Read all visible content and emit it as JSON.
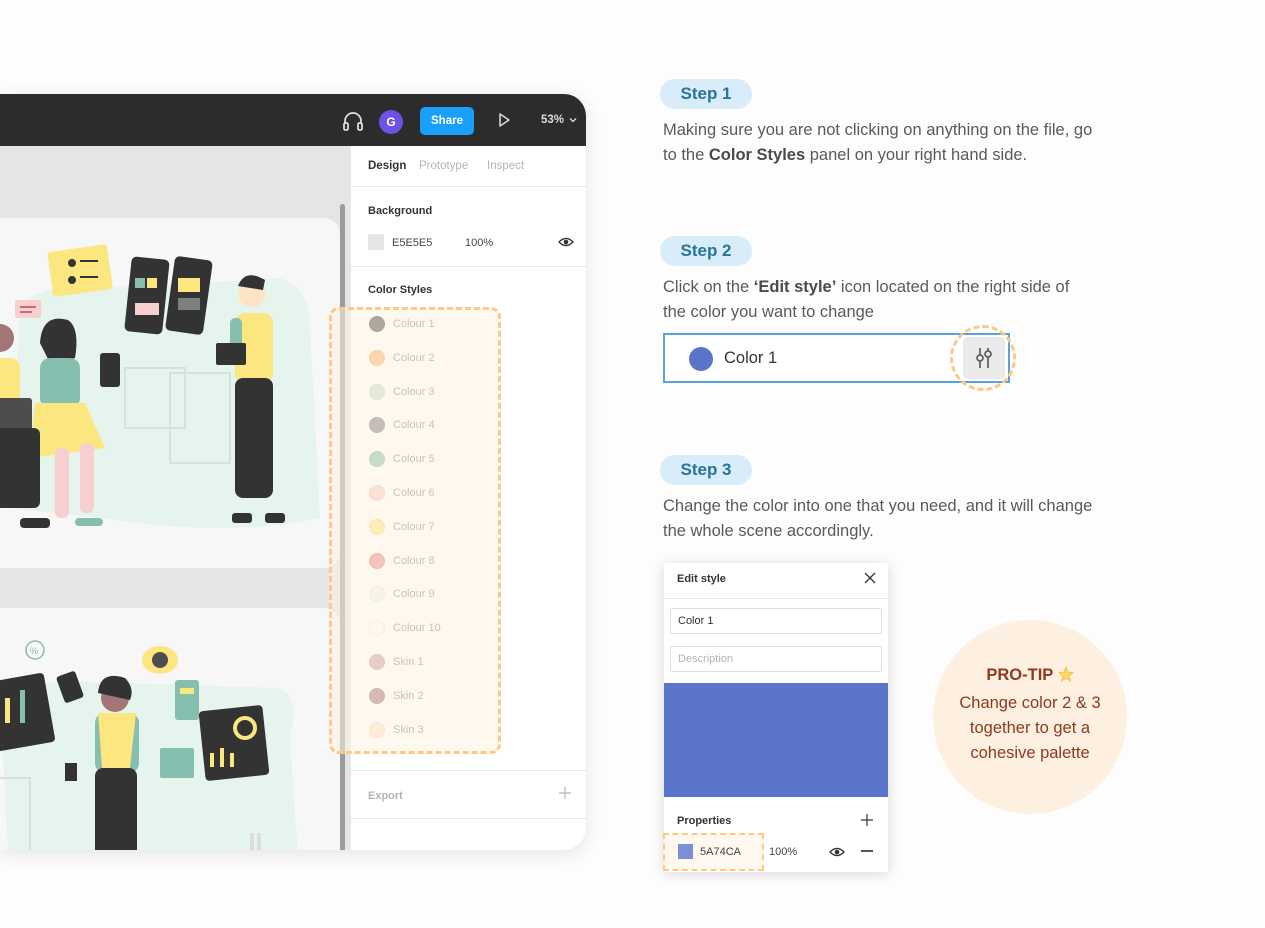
{
  "figma": {
    "avatar_initial": "G",
    "share_label": "Share",
    "zoom": "53%",
    "tabs": [
      "Design",
      "Prototype",
      "Inspect"
    ],
    "background": {
      "title": "Background",
      "hex": "E5E5E5",
      "opacity": "100%",
      "color": "#e5e5e5"
    },
    "color_styles_title": "Color Styles",
    "color_styles": [
      {
        "name": "Colour 1",
        "color": "#4d4d4d"
      },
      {
        "name": "Colour 2",
        "color": "#f5b76a"
      },
      {
        "name": "Colour 3",
        "color": "#c8e3cf"
      },
      {
        "name": "Colour 4",
        "color": "#7b7f80"
      },
      {
        "name": "Colour 5",
        "color": "#86bfaf"
      },
      {
        "name": "Colour 6",
        "color": "#f7cfcf"
      },
      {
        "name": "Colour 7",
        "color": "#fce680"
      },
      {
        "name": "Colour 8",
        "color": "#e88a8f"
      },
      {
        "name": "Colour 9",
        "color": "#e9f6ec"
      },
      {
        "name": "Colour 10",
        "color": "#ffffff"
      },
      {
        "name": "Skin 1",
        "color": "#c9a3a3"
      },
      {
        "name": "Skin 2",
        "color": "#a27676"
      },
      {
        "name": "Skin 3",
        "color": "#fde4c7"
      }
    ],
    "export_label": "Export"
  },
  "steps": [
    {
      "label": "Step 1",
      "text_parts": [
        "Making sure you are not clicking on anything on the file, go to the ",
        "Color Styles",
        " panel on your right hand side."
      ]
    },
    {
      "label": "Step 2",
      "text_parts": [
        "Click on the ",
        "‘Edit style’",
        " icon located on the right side of the color you want to change"
      ]
    },
    {
      "label": "Step 3",
      "text_parts": [
        "Change the color into one that you need, and it will change the whole scene accordingly."
      ]
    }
  ],
  "color1_row": {
    "name": "Color 1",
    "color": "#5a74ca"
  },
  "edit_style": {
    "title": "Edit style",
    "name_value": "Color 1",
    "description_placeholder": "Description",
    "color": "#5a74ca",
    "properties_title": "Properties",
    "hex": "5A74CA",
    "opacity": "100%"
  },
  "protip": {
    "title": "PRO-TIP",
    "body": "Change color 2 & 3 together to get a cohesive palette"
  }
}
